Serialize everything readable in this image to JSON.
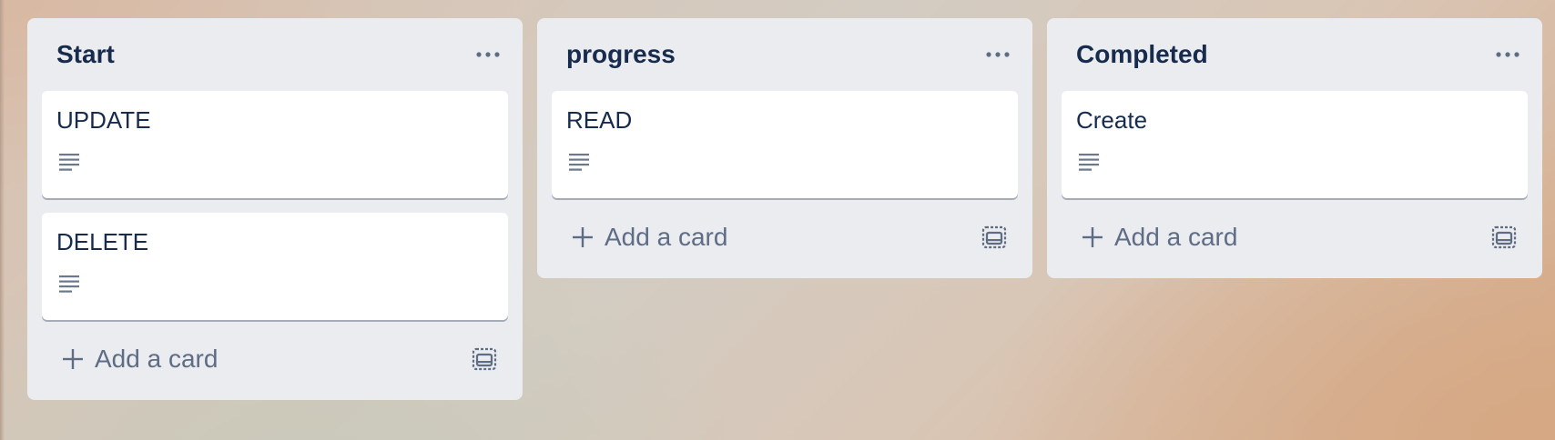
{
  "board": {
    "lists": [
      {
        "title": "Start",
        "cards": [
          {
            "title": "UPDATE"
          },
          {
            "title": "DELETE"
          }
        ],
        "add_card_label": "Add a card"
      },
      {
        "title": "progress",
        "cards": [
          {
            "title": "READ"
          }
        ],
        "add_card_label": "Add a card"
      },
      {
        "title": "Completed",
        "cards": [
          {
            "title": "Create"
          }
        ],
        "add_card_label": "Add a card"
      }
    ]
  },
  "icons": {
    "list_menu": "more-horizontal-icon",
    "card_badge": "description-icon",
    "add": "plus-icon",
    "template": "card-template-icon"
  },
  "colors": {
    "list_bg": "#ebecf0",
    "card_bg": "#ffffff",
    "title_text": "#172b4d",
    "muted_text": "#5e6c84"
  }
}
